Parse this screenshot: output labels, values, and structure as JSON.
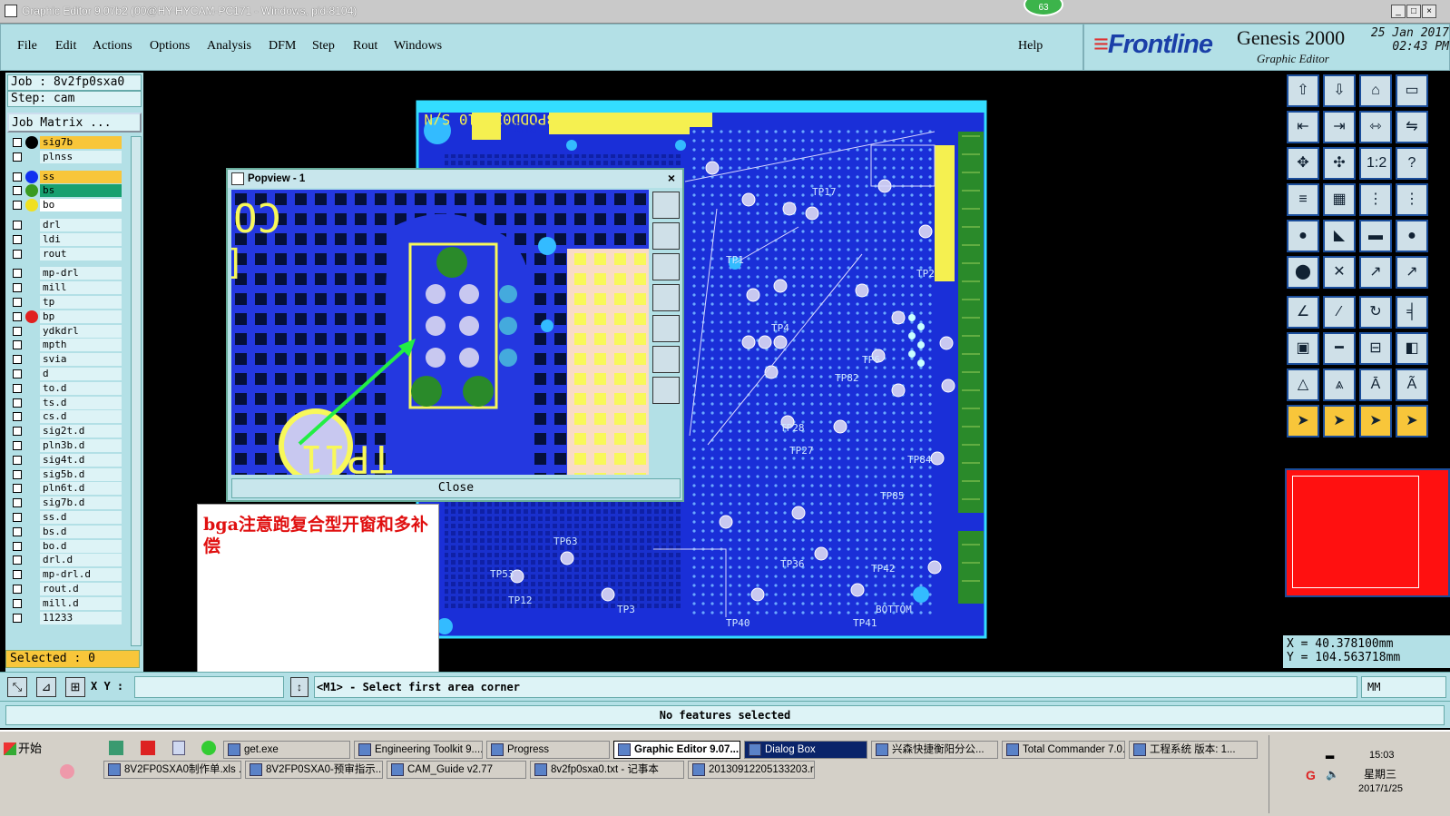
{
  "window": {
    "title": "Graphic Editor 9.07b2 (00@HY-HYCAM-PC171 - Windows, pid:8104)",
    "badge": "63"
  },
  "menu": [
    "File",
    "Edit",
    "Actions",
    "Options",
    "Analysis",
    "DFM",
    "Step",
    "Rout",
    "Windows"
  ],
  "help": "Help",
  "brand": {
    "logo": "Frontline",
    "product": "Genesis 2000",
    "subtitle": "Graphic Editor",
    "date": "25 Jan 2017",
    "time": "02:43 PM"
  },
  "job": {
    "job_label": "Job : 8v2fp0sxa0",
    "step_label": "Step: cam",
    "matrix_button": "Job Matrix ..."
  },
  "layers": [
    {
      "name": "sig7b",
      "color": "#f8c63a",
      "dot": "#000000"
    },
    {
      "name": "plnss",
      "color": "#ddf3f6",
      "dot": ""
    },
    {
      "name": "ss",
      "color": "#f8c63a",
      "dot": "#1030f0"
    },
    {
      "name": "bs",
      "color": "#18a070",
      "dot": "#3a9a20"
    },
    {
      "name": "bo",
      "color": "#ffffff",
      "dot": "#f0e020"
    },
    {
      "name": "drl",
      "color": "#ddf3f6",
      "dot": ""
    },
    {
      "name": "ldi",
      "color": "#ddf3f6",
      "dot": ""
    },
    {
      "name": "rout",
      "color": "#ddf3f6",
      "dot": ""
    },
    {
      "name": "mp-drl",
      "color": "#ddf3f6",
      "dot": ""
    },
    {
      "name": "mill",
      "color": "#ddf3f6",
      "dot": ""
    },
    {
      "name": "tp",
      "color": "#ddf3f6",
      "dot": ""
    },
    {
      "name": "bp",
      "color": "#ddf3f6",
      "dot": "#e02020"
    },
    {
      "name": "ydkdrl",
      "color": "#ddf3f6",
      "dot": ""
    },
    {
      "name": "mpth",
      "color": "#ddf3f6",
      "dot": ""
    },
    {
      "name": "svia",
      "color": "#ddf3f6",
      "dot": ""
    },
    {
      "name": "d",
      "color": "#ddf3f6",
      "dot": ""
    },
    {
      "name": "to.d",
      "color": "#ddf3f6",
      "dot": ""
    },
    {
      "name": "ts.d",
      "color": "#ddf3f6",
      "dot": ""
    },
    {
      "name": "cs.d",
      "color": "#ddf3f6",
      "dot": ""
    },
    {
      "name": "sig2t.d",
      "color": "#ddf3f6",
      "dot": ""
    },
    {
      "name": "pln3b.d",
      "color": "#ddf3f6",
      "dot": ""
    },
    {
      "name": "sig4t.d",
      "color": "#ddf3f6",
      "dot": ""
    },
    {
      "name": "sig5b.d",
      "color": "#ddf3f6",
      "dot": ""
    },
    {
      "name": "pln6t.d",
      "color": "#ddf3f6",
      "dot": ""
    },
    {
      "name": "sig7b.d",
      "color": "#ddf3f6",
      "dot": ""
    },
    {
      "name": "ss.d",
      "color": "#ddf3f6",
      "dot": ""
    },
    {
      "name": "bs.d",
      "color": "#ddf3f6",
      "dot": ""
    },
    {
      "name": "bo.d",
      "color": "#ddf3f6",
      "dot": ""
    },
    {
      "name": "drl.d",
      "color": "#ddf3f6",
      "dot": ""
    },
    {
      "name": "mp-drl.d",
      "color": "#ddf3f6",
      "dot": ""
    },
    {
      "name": "rout.d",
      "color": "#ddf3f6",
      "dot": ""
    },
    {
      "name": "mill.d",
      "color": "#ddf3f6",
      "dot": ""
    },
    {
      "name": "11233",
      "color": "#ddf3f6",
      "dot": ""
    }
  ],
  "selected": "Selected : 0",
  "popview": {
    "title": "Popview - 1",
    "close": "Close",
    "board_text_1": "CONG",
    "board_text_2": "[Prog_L",
    "board_text_3": "TP11"
  },
  "note": "bga注意跑复合型开窗和多补偿",
  "board": {
    "top_text": "1ESD 3PODD03 110 S/N",
    "ind": "Ind.",
    "bottom_text": "BOTTOM"
  },
  "coords": {
    "x": "X  =  40.378100mm",
    "y": "Y  = 104.563718mm"
  },
  "bottom": {
    "xy_label": "X Y :",
    "xy_value": "",
    "prompt": "<M1> - Select first area corner",
    "units": "MM",
    "status": "No features selected"
  },
  "taskbar": {
    "start": "开始",
    "row1": [
      "get.exe",
      "Engineering Toolkit 9....",
      "Progress",
      "Graphic Editor 9.07...",
      "Dialog Box",
      "兴森快捷衡阳分公...",
      "Total Commander 7.0...",
      "工程系统  版本: 1..."
    ],
    "row2": [
      "8V2FP0SXA0制作单.xls ...",
      "8V2FP0SXA0-预审指示....",
      "CAM_Guide v2.77",
      "8v2fp0sxa0.txt - 记事本",
      "20130912205133203.rtf..."
    ],
    "clock_time": "15:03",
    "clock_day": "星期三",
    "clock_date": "2017/1/25"
  }
}
